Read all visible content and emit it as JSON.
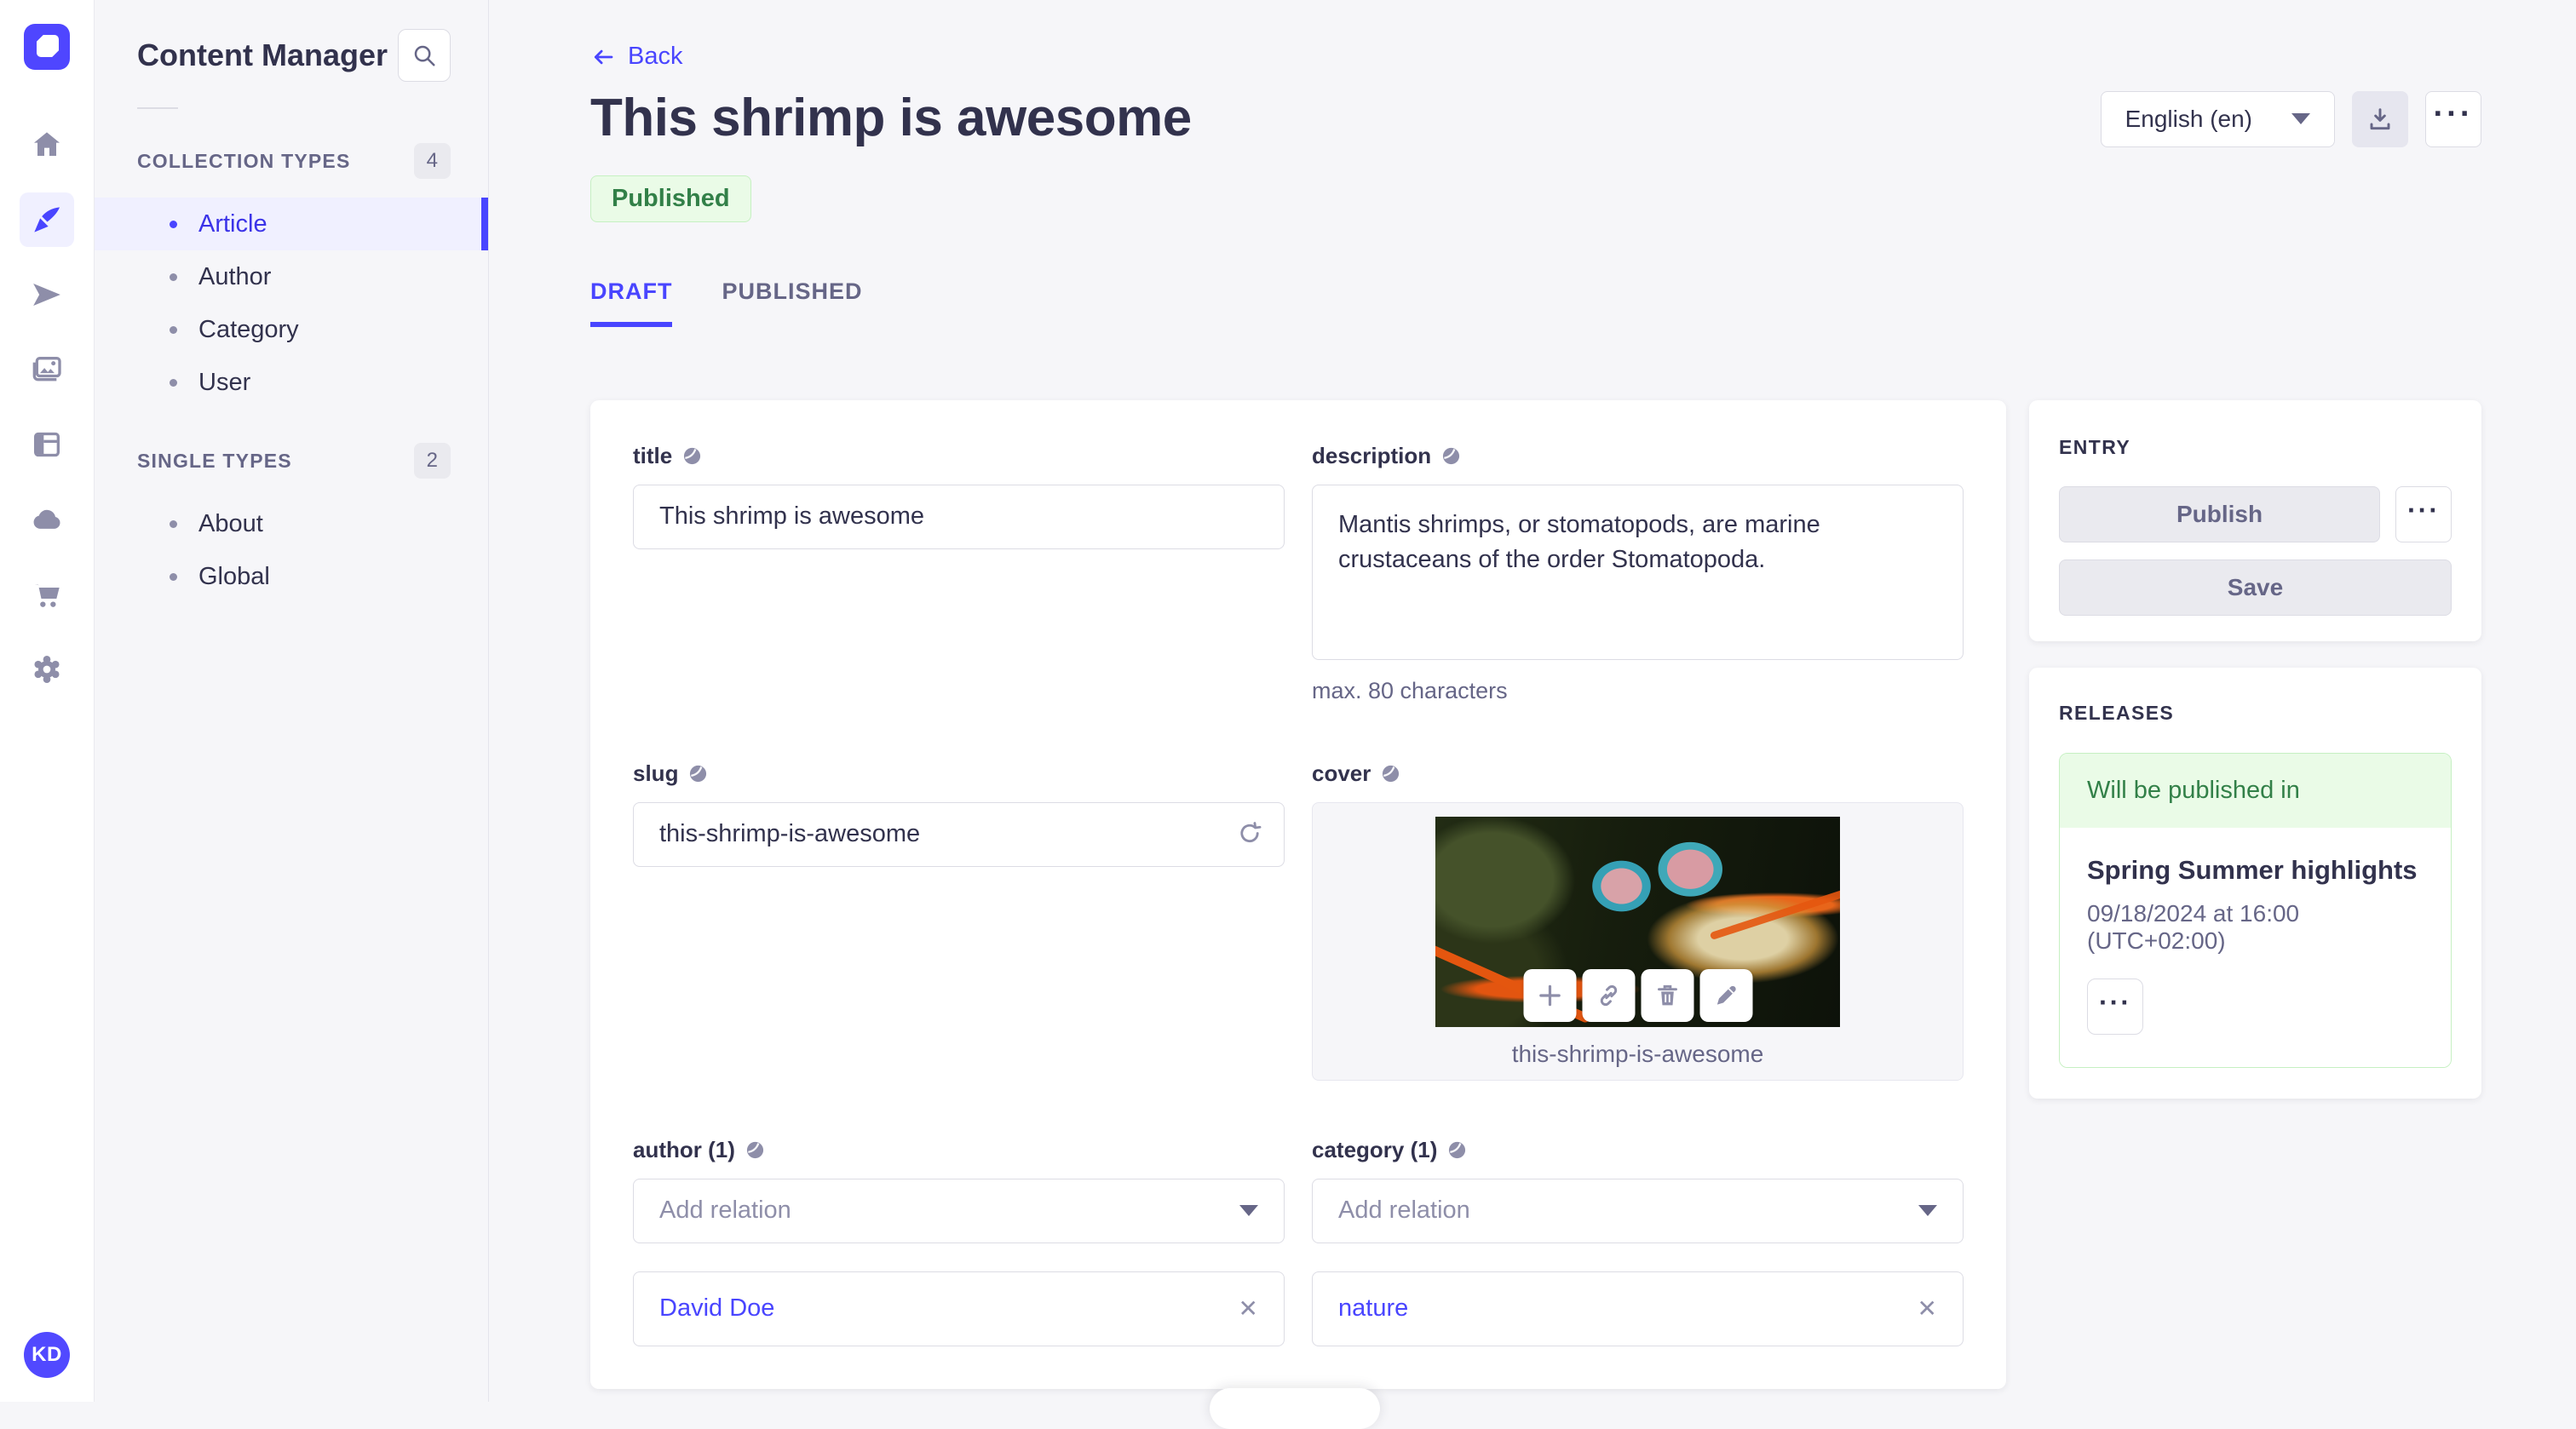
{
  "nav_rail": {
    "logo_icon": "strapi-logo",
    "icons": [
      {
        "name": "home-icon",
        "active": false
      },
      {
        "name": "content-manager-icon",
        "active": true
      },
      {
        "name": "paper-plane-icon",
        "active": false
      },
      {
        "name": "media-library-icon",
        "active": false
      },
      {
        "name": "content-type-builder-icon",
        "active": false
      },
      {
        "name": "cloud-icon",
        "active": false
      },
      {
        "name": "marketplace-cart-icon",
        "active": false
      },
      {
        "name": "settings-gear-icon",
        "active": false
      }
    ],
    "avatar_initials": "KD"
  },
  "sidebar": {
    "title": "Content Manager",
    "search_icon": "search-icon",
    "sections": [
      {
        "label": "COLLECTION TYPES",
        "count": "4",
        "items": [
          {
            "label": "Article",
            "active": true
          },
          {
            "label": "Author",
            "active": false
          },
          {
            "label": "Category",
            "active": false
          },
          {
            "label": "User",
            "active": false
          }
        ]
      },
      {
        "label": "SINGLE TYPES",
        "count": "2",
        "items": [
          {
            "label": "About",
            "active": false
          },
          {
            "label": "Global",
            "active": false
          }
        ]
      }
    ]
  },
  "header": {
    "back_label": "Back",
    "title": "This shrimp is awesome",
    "status_badge": "Published",
    "tabs": [
      {
        "label": "DRAFT",
        "active": true
      },
      {
        "label": "PUBLISHED",
        "active": false
      }
    ],
    "locale_select": {
      "value": "English (en)"
    },
    "download_icon": "download-icon",
    "more_icon": "more-horizontal-icon"
  },
  "form": {
    "title_field": {
      "label": "title",
      "value": "This shrimp is awesome"
    },
    "description_field": {
      "label": "description",
      "value": "Mantis shrimps, or stomatopods, are marine crustaceans of the order Stomatopoda.",
      "helper": "max. 80 characters"
    },
    "slug_field": {
      "label": "slug",
      "value": "this-shrimp-is-awesome",
      "regenerate_icon": "refresh-icon"
    },
    "cover_field": {
      "label": "cover",
      "image_caption": "this-shrimp-is-awesome",
      "toolbar_icons": [
        "plus-icon",
        "link-icon",
        "trash-icon",
        "pencil-icon"
      ]
    },
    "author_field": {
      "label": "author (1)",
      "placeholder": "Add relation",
      "relations": [
        {
          "label": "David Doe"
        }
      ]
    },
    "category_field": {
      "label": "category (1)",
      "placeholder": "Add relation",
      "relations": [
        {
          "label": "nature"
        }
      ]
    }
  },
  "entry_panel": {
    "title": "ENTRY",
    "publish_label": "Publish",
    "save_label": "Save"
  },
  "releases_panel": {
    "title": "RELEASES",
    "release": {
      "status": "Will be published in",
      "name": "Spring Summer highlights",
      "datetime": "09/18/2024 at 16:00 (UTC+02:00)"
    }
  },
  "colors": {
    "primary": "#4945ff",
    "primary_light": "#f0f0ff",
    "success_text": "#328048",
    "success_bg": "#eafbe7",
    "success_border": "#c6f0c2",
    "page_bg": "#f6f6f9",
    "border": "#dcdce4",
    "text": "#32324d",
    "text_muted": "#666687"
  }
}
